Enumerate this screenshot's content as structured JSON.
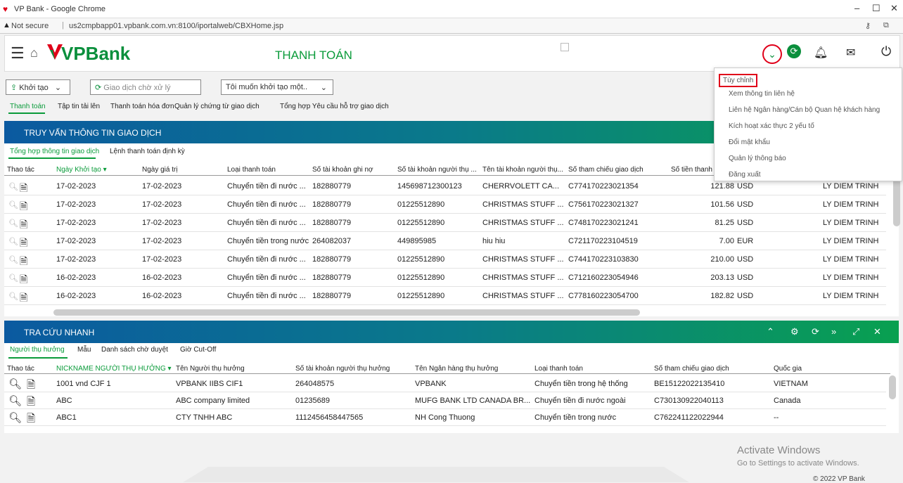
{
  "browser": {
    "window_title": "VP Bank - Google Chrome",
    "security": "Not secure",
    "url": "us2cmpbapp01.vpbank.com.vn:8100/iportalweb/CBXHome.jsp"
  },
  "brand": {
    "name": "VPBank",
    "page_title": "THANH TOÁN"
  },
  "toolbar": {
    "init_label": "Khởi tạo",
    "pending_label": "Giao dịch chờ xử lý",
    "want_label": "Tôi muốn khởi tạo một.."
  },
  "main_tabs": [
    "Thanh toán",
    "Tập tin tải lên",
    "Thanh toán hóa đơn",
    "Quản lý chứng từ giao dịch",
    "Tổng hợp Yêu cầu hỗ trợ giao dịch"
  ],
  "tx_panel": {
    "title": "TRUY VẤN THÔNG TIN GIAO DỊCH",
    "tabs": [
      "Tổng hợp thông tin giao dịch",
      "Lệnh thanh toán định kỳ"
    ],
    "columns": [
      "Thao tác",
      "Ngày Khởi tạo ▾",
      "Ngày giá trị",
      "Loại thanh toán",
      "Số tài khoản ghi nợ",
      "Số tài khoản người thụ ...",
      "Tên tài khoản người thụ...",
      "Số tham chiếu giao dịch",
      "Số tiền thanh t"
    ],
    "rows": [
      [
        "17-02-2023",
        "17-02-2023",
        "Chuyển tiền đi nước ...",
        "182880779",
        "145698712300123",
        "CHERRVOLETT CA...",
        "C774170223021354",
        "121.88",
        "USD",
        "LY DIEM TRINH"
      ],
      [
        "17-02-2023",
        "17-02-2023",
        "Chuyển tiền đi nước ...",
        "182880779",
        "01225512890",
        "CHRISTMAS STUFF ...",
        "C756170223021327",
        "101.56",
        "USD",
        "LY DIEM TRINH"
      ],
      [
        "17-02-2023",
        "17-02-2023",
        "Chuyển tiền đi nước ...",
        "182880779",
        "01225512890",
        "CHRISTMAS STUFF ...",
        "C748170223021241",
        "81.25",
        "USD",
        "LY DIEM TRINH"
      ],
      [
        "17-02-2023",
        "17-02-2023",
        "Chuyển tiền trong nước",
        "264082037",
        "449895985",
        "hiu hiu",
        "C721170223104519",
        "7.00",
        "EUR",
        "LY DIEM TRINH"
      ],
      [
        "17-02-2023",
        "17-02-2023",
        "Chuyển tiền đi nước ...",
        "182880779",
        "01225512890",
        "CHRISTMAS STUFF ...",
        "C744170223103830",
        "210.00",
        "USD",
        "LY DIEM TRINH"
      ],
      [
        "16-02-2023",
        "16-02-2023",
        "Chuyển tiền đi nước ...",
        "182880779",
        "01225512890",
        "CHRISTMAS STUFF ...",
        "C712160223054946",
        "203.13",
        "USD",
        "LY DIEM TRINH"
      ],
      [
        "16-02-2023",
        "16-02-2023",
        "Chuyển tiền đi nước ...",
        "182880779",
        "01225512890",
        "CHRISTMAS STUFF ...",
        "C778160223054700",
        "182.82",
        "USD",
        "LY DIEM TRINH"
      ]
    ]
  },
  "quick_panel": {
    "title": "TRA CỨU NHANH",
    "tabs": [
      "Người thụ hưởng",
      "Mẫu",
      "Danh sách chờ duyệt",
      "Giờ Cut-Off"
    ],
    "columns": [
      "Thao tác",
      "NICKNAME NGƯỜI THỤ HƯỞNG ▾",
      "Tên Người thụ hưởng",
      "Số tài khoản người thụ hưởng",
      "Tên Ngân hàng thụ hưởng",
      "Loại thanh toán",
      "Số tham chiếu giao dịch",
      "Quốc gia"
    ],
    "rows": [
      [
        "1001 vnd CJF 1",
        "VPBANK IIBS CIF1",
        "264048575",
        "VPBANK",
        "Chuyển tiền trong hệ thống",
        "BE15122022135410",
        "VIETNAM"
      ],
      [
        "ABC",
        "ABC company limited",
        "01235689",
        "MUFG BANK LTD CANADA BR...",
        "Chuyển tiền đi nước ngoài",
        "C730130922040113",
        "Canada"
      ],
      [
        "ABC1",
        "CTY TNHH ABC",
        "1112456458447565",
        "NH Cong Thuong",
        "Chuyển tiền trong nước",
        "C762241122022944",
        "--"
      ]
    ]
  },
  "user_menu": [
    "Tùy chỉnh",
    "Xem thông tin liên hệ",
    "Liên hệ Ngân hàng/Cán bộ Quan hệ khách hàng",
    "Kích hoạt xác thực 2 yếu tố",
    "Đổi mật khẩu",
    "Quản lý thông báo",
    "Đăng xuất"
  ],
  "watermark": {
    "line1": "Activate Windows",
    "line2": "Go to Settings to activate Windows.",
    "copyright": "© 2022 VP Bank"
  },
  "colors": {
    "accent": "#0a9b3a",
    "highlight": "#e0001a"
  }
}
